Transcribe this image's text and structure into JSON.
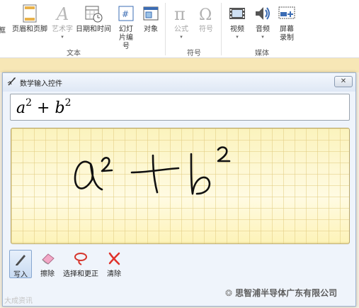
{
  "ribbon": {
    "items": [
      {
        "label": "框",
        "enabled": true
      },
      {
        "label": "页眉和页脚",
        "enabled": true
      },
      {
        "label": "艺术字",
        "enabled": false,
        "has_caret": true
      },
      {
        "label": "日期和时间",
        "enabled": true
      },
      {
        "label": "幻灯片编号",
        "enabled": true
      },
      {
        "label": "对象",
        "enabled": true
      },
      {
        "label": "公式",
        "enabled": false,
        "has_caret": true
      },
      {
        "label": "符号",
        "enabled": false
      },
      {
        "label": "视频",
        "enabled": true,
        "has_caret": true
      },
      {
        "label": "音频",
        "enabled": true,
        "has_caret": true
      },
      {
        "label": "屏幕录制",
        "enabled": true
      }
    ],
    "groups": {
      "text": "文本",
      "symbols": "符号",
      "media": "媒体"
    }
  },
  "dialog": {
    "title": "数学输入控件",
    "close_icon": "close-icon",
    "preview": {
      "base1": "a",
      "exp1": "2",
      "op": "+",
      "base2": "b",
      "exp2": "2"
    },
    "tools": [
      {
        "label": "写入",
        "icon": "pen-icon",
        "active": true
      },
      {
        "label": "擦除",
        "icon": "eraser-icon",
        "active": false
      },
      {
        "label": "选择和更正",
        "icon": "lasso-icon",
        "active": false
      },
      {
        "label": "清除",
        "icon": "clear-icon",
        "active": false
      }
    ]
  },
  "watermarks": {
    "left": "大成资讯",
    "right": "思智浦半导体广东有限公司"
  },
  "colors": {
    "pad_background": "#fdf6c4",
    "ink": "#111111",
    "clear_red": "#e0322b",
    "accent_orange_strip": "#f7e7b6"
  }
}
